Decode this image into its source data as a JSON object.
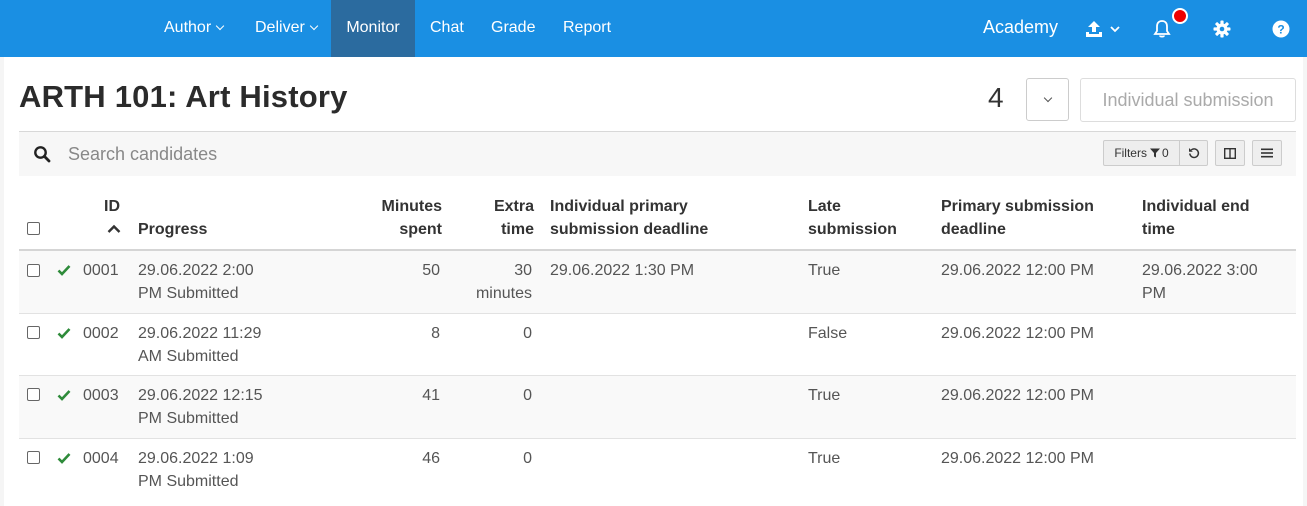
{
  "nav": {
    "items": [
      {
        "label": "Author"
      },
      {
        "label": "Deliver"
      },
      {
        "label": "Monitor"
      },
      {
        "label": "Chat"
      },
      {
        "label": "Grade"
      },
      {
        "label": "Report"
      }
    ],
    "org": "Academy"
  },
  "page": {
    "title": "ARTH 101: Art History",
    "count": "4",
    "individual_submission": "Individual submission"
  },
  "search": {
    "placeholder": "Search candidates"
  },
  "toolbar": {
    "filters_label": "Filters",
    "filters_count": "0"
  },
  "table": {
    "columns": {
      "id": "ID",
      "progress": "Progress",
      "minutes": [
        "Minutes",
        "spent"
      ],
      "extra": [
        "Extra",
        "time"
      ],
      "ind_deadline": [
        "Individual primary",
        "submission deadline"
      ],
      "late": [
        "Late",
        "submission"
      ],
      "primary_deadline": [
        "Primary submission",
        "deadline"
      ],
      "ind_end": [
        "Individual end",
        "time"
      ]
    },
    "rows": [
      {
        "id": "0001",
        "progress": [
          "29.06.2022 2:00",
          "PM Submitted"
        ],
        "minutes": "50",
        "extra": [
          "30",
          "minutes"
        ],
        "ind_deadline": "29.06.2022 1:30 PM",
        "late": "True",
        "primary_deadline": "29.06.2022 12:00 PM",
        "ind_end": [
          "29.06.2022 3:00",
          "PM"
        ]
      },
      {
        "id": "0002",
        "progress": [
          "29.06.2022 11:29",
          "AM Submitted"
        ],
        "minutes": "8",
        "extra": [
          "0",
          ""
        ],
        "ind_deadline": "",
        "late": "False",
        "primary_deadline": "29.06.2022 12:00 PM",
        "ind_end": [
          "",
          ""
        ]
      },
      {
        "id": "0003",
        "progress": [
          "29.06.2022 12:15",
          "PM Submitted"
        ],
        "minutes": "41",
        "extra": [
          "0",
          ""
        ],
        "ind_deadline": "",
        "late": "True",
        "primary_deadline": "29.06.2022 12:00 PM",
        "ind_end": [
          "",
          ""
        ]
      },
      {
        "id": "0004",
        "progress": [
          "29.06.2022 1:09",
          "PM Submitted"
        ],
        "minutes": "46",
        "extra": [
          "0",
          ""
        ],
        "ind_deadline": "",
        "late": "True",
        "primary_deadline": "29.06.2022 12:00 PM",
        "ind_end": [
          "",
          ""
        ]
      }
    ]
  },
  "colors": {
    "topbar": "#1a8fe3",
    "active_nav": "#2b6b9f",
    "check_green": "#2e8b3a",
    "notification": "#e00000"
  }
}
